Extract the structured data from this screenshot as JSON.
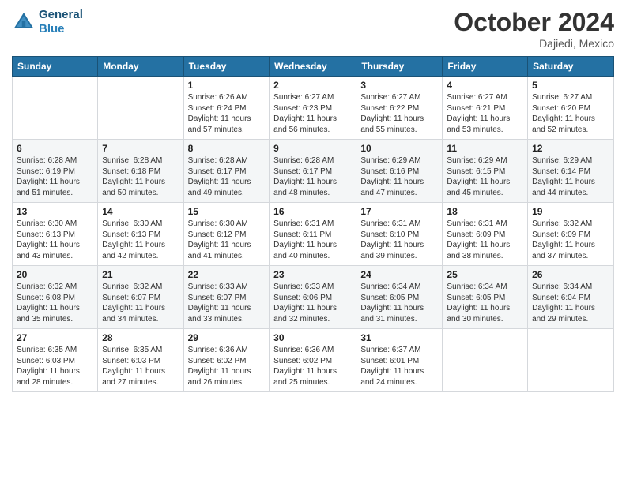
{
  "header": {
    "logo_line1": "General",
    "logo_line2": "Blue",
    "month": "October 2024",
    "location": "Dajiedi, Mexico"
  },
  "days_of_week": [
    "Sunday",
    "Monday",
    "Tuesday",
    "Wednesday",
    "Thursday",
    "Friday",
    "Saturday"
  ],
  "weeks": [
    [
      {
        "day": "",
        "info": ""
      },
      {
        "day": "",
        "info": ""
      },
      {
        "day": "1",
        "info": "Sunrise: 6:26 AM\nSunset: 6:24 PM\nDaylight: 11 hours and 57 minutes."
      },
      {
        "day": "2",
        "info": "Sunrise: 6:27 AM\nSunset: 6:23 PM\nDaylight: 11 hours and 56 minutes."
      },
      {
        "day": "3",
        "info": "Sunrise: 6:27 AM\nSunset: 6:22 PM\nDaylight: 11 hours and 55 minutes."
      },
      {
        "day": "4",
        "info": "Sunrise: 6:27 AM\nSunset: 6:21 PM\nDaylight: 11 hours and 53 minutes."
      },
      {
        "day": "5",
        "info": "Sunrise: 6:27 AM\nSunset: 6:20 PM\nDaylight: 11 hours and 52 minutes."
      }
    ],
    [
      {
        "day": "6",
        "info": "Sunrise: 6:28 AM\nSunset: 6:19 PM\nDaylight: 11 hours and 51 minutes."
      },
      {
        "day": "7",
        "info": "Sunrise: 6:28 AM\nSunset: 6:18 PM\nDaylight: 11 hours and 50 minutes."
      },
      {
        "day": "8",
        "info": "Sunrise: 6:28 AM\nSunset: 6:17 PM\nDaylight: 11 hours and 49 minutes."
      },
      {
        "day": "9",
        "info": "Sunrise: 6:28 AM\nSunset: 6:17 PM\nDaylight: 11 hours and 48 minutes."
      },
      {
        "day": "10",
        "info": "Sunrise: 6:29 AM\nSunset: 6:16 PM\nDaylight: 11 hours and 47 minutes."
      },
      {
        "day": "11",
        "info": "Sunrise: 6:29 AM\nSunset: 6:15 PM\nDaylight: 11 hours and 45 minutes."
      },
      {
        "day": "12",
        "info": "Sunrise: 6:29 AM\nSunset: 6:14 PM\nDaylight: 11 hours and 44 minutes."
      }
    ],
    [
      {
        "day": "13",
        "info": "Sunrise: 6:30 AM\nSunset: 6:13 PM\nDaylight: 11 hours and 43 minutes."
      },
      {
        "day": "14",
        "info": "Sunrise: 6:30 AM\nSunset: 6:13 PM\nDaylight: 11 hours and 42 minutes."
      },
      {
        "day": "15",
        "info": "Sunrise: 6:30 AM\nSunset: 6:12 PM\nDaylight: 11 hours and 41 minutes."
      },
      {
        "day": "16",
        "info": "Sunrise: 6:31 AM\nSunset: 6:11 PM\nDaylight: 11 hours and 40 minutes."
      },
      {
        "day": "17",
        "info": "Sunrise: 6:31 AM\nSunset: 6:10 PM\nDaylight: 11 hours and 39 minutes."
      },
      {
        "day": "18",
        "info": "Sunrise: 6:31 AM\nSunset: 6:09 PM\nDaylight: 11 hours and 38 minutes."
      },
      {
        "day": "19",
        "info": "Sunrise: 6:32 AM\nSunset: 6:09 PM\nDaylight: 11 hours and 37 minutes."
      }
    ],
    [
      {
        "day": "20",
        "info": "Sunrise: 6:32 AM\nSunset: 6:08 PM\nDaylight: 11 hours and 35 minutes."
      },
      {
        "day": "21",
        "info": "Sunrise: 6:32 AM\nSunset: 6:07 PM\nDaylight: 11 hours and 34 minutes."
      },
      {
        "day": "22",
        "info": "Sunrise: 6:33 AM\nSunset: 6:07 PM\nDaylight: 11 hours and 33 minutes."
      },
      {
        "day": "23",
        "info": "Sunrise: 6:33 AM\nSunset: 6:06 PM\nDaylight: 11 hours and 32 minutes."
      },
      {
        "day": "24",
        "info": "Sunrise: 6:34 AM\nSunset: 6:05 PM\nDaylight: 11 hours and 31 minutes."
      },
      {
        "day": "25",
        "info": "Sunrise: 6:34 AM\nSunset: 6:05 PM\nDaylight: 11 hours and 30 minutes."
      },
      {
        "day": "26",
        "info": "Sunrise: 6:34 AM\nSunset: 6:04 PM\nDaylight: 11 hours and 29 minutes."
      }
    ],
    [
      {
        "day": "27",
        "info": "Sunrise: 6:35 AM\nSunset: 6:03 PM\nDaylight: 11 hours and 28 minutes."
      },
      {
        "day": "28",
        "info": "Sunrise: 6:35 AM\nSunset: 6:03 PM\nDaylight: 11 hours and 27 minutes."
      },
      {
        "day": "29",
        "info": "Sunrise: 6:36 AM\nSunset: 6:02 PM\nDaylight: 11 hours and 26 minutes."
      },
      {
        "day": "30",
        "info": "Sunrise: 6:36 AM\nSunset: 6:02 PM\nDaylight: 11 hours and 25 minutes."
      },
      {
        "day": "31",
        "info": "Sunrise: 6:37 AM\nSunset: 6:01 PM\nDaylight: 11 hours and 24 minutes."
      },
      {
        "day": "",
        "info": ""
      },
      {
        "day": "",
        "info": ""
      }
    ]
  ]
}
